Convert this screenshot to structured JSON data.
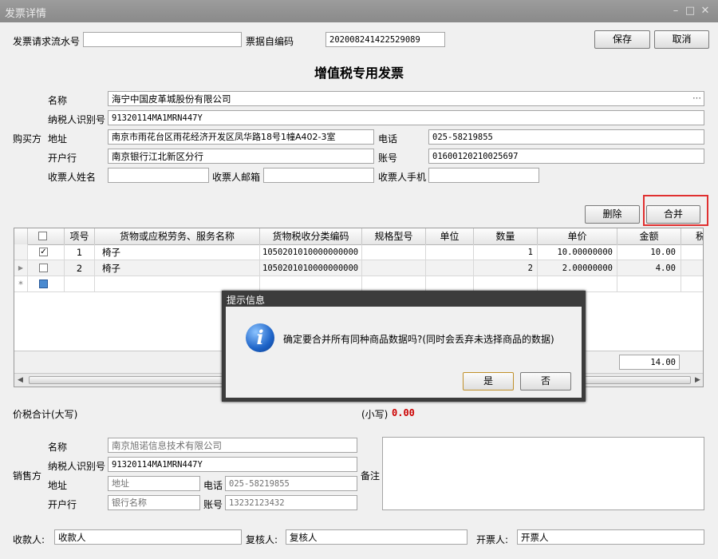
{
  "window": {
    "title": "发票详情"
  },
  "header": {
    "serial_label": "发票请求流水号",
    "serial_value": "",
    "code_label": "票据自编码",
    "code_value": "202008241422529089",
    "save_label": "保存",
    "cancel_label": "取消"
  },
  "invoice_title": "增值税专用发票",
  "buyer": {
    "section_label": "购买方",
    "name_label": "名称",
    "name_value": "海宁中国皮革城股份有限公司",
    "more_label": "···",
    "taxid_label": "纳税人识别号",
    "taxid_value": "91320114MA1MRN447Y",
    "address_label": "地址",
    "address_value": "南京市雨花台区雨花经济开发区凤华路18号1幢A402-3室",
    "phone_label": "电话",
    "phone_value": "025-58219855",
    "bank_label": "开户行",
    "bank_value": "南京银行江北新区分行",
    "account_label": "账号",
    "account_value": "01600120210025697",
    "recv_name_label": "收票人姓名",
    "recv_name_value": "",
    "recv_email_label": "收票人邮箱",
    "recv_email_value": "",
    "recv_phone_label": "收票人手机",
    "recv_phone_value": ""
  },
  "grid_toolbar": {
    "delete_label": "删除",
    "merge_label": "合并"
  },
  "grid": {
    "columns": [
      "项号",
      "货物或应税劳务、服务名称",
      "货物税收分类编码",
      "规格型号",
      "单位",
      "数量",
      "单价",
      "金额",
      "税"
    ],
    "rows": [
      {
        "checked": true,
        "no": "1",
        "name": "椅子",
        "code": "1050201010000000000",
        "spec": "",
        "unit": "",
        "qty": "1",
        "price": "10.00000000",
        "amount": "10.00"
      },
      {
        "checked": false,
        "no": "2",
        "name": "椅子",
        "code": "1050201010000000000",
        "spec": "",
        "unit": "",
        "qty": "2",
        "price": "2.00000000",
        "amount": "4.00"
      }
    ],
    "new_row_marker": "*",
    "total_amount": "14.00"
  },
  "totals": {
    "uppercase_label": "价税合计(大写)",
    "lowercase_label": "(小写)",
    "lowercase_value": "0.00",
    "lowercase_color": "#cc0000"
  },
  "seller": {
    "section_label": "销售方",
    "name_label": "名称",
    "name_value": "南京旭诺信息技术有限公司",
    "taxid_label": "纳税人识别号",
    "taxid_value": "91320114MA1MRN447Y",
    "address_label": "地址",
    "address_placeholder": "地址",
    "phone_label": "电话",
    "phone_value": "025-58219855",
    "bank_label": "开户行",
    "bank_placeholder": "银行名称",
    "account_label": "账号",
    "account_value": "13232123432",
    "remark_label": "备注"
  },
  "footer": {
    "payee_label": "收款人:",
    "payee_value": "收款人",
    "reviewer_label": "复核人:",
    "reviewer_value": "复核人",
    "drawer_label": "开票人:",
    "drawer_value": "开票人"
  },
  "dialog": {
    "title": "提示信息",
    "message": "确定要合并所有同种商品数据吗?(同时会丢弃未选择商品的数据)",
    "icon": "info-icon",
    "yes_label": "是",
    "no_label": "否"
  }
}
